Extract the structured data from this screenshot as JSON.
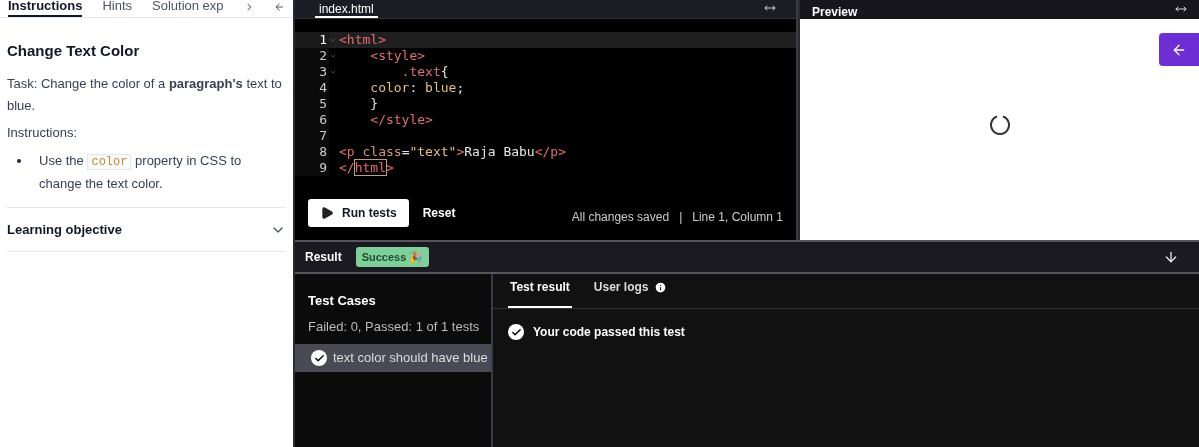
{
  "instructions_panel": {
    "tabs": [
      {
        "label": "Instructions",
        "selected": true
      },
      {
        "label": "Hints",
        "selected": false
      },
      {
        "label": "Solution exp",
        "selected": false
      }
    ],
    "title": "Change Text Color",
    "task": "Task: Change the color of a **paragraph's** text to blue.",
    "instructions_label": "Instructions:",
    "bullets": [
      {
        "before": "Use the",
        "code": "color",
        "after": "property in CSS to change the text color."
      }
    ],
    "accordion": {
      "label": "Learning objective",
      "expanded": false
    }
  },
  "editor": {
    "tab": {
      "label": "index.html",
      "selected": true
    },
    "lines": [
      {
        "number": "1",
        "fold": true,
        "current": true,
        "tokens": [
          {
            "kind": "tag",
            "text": "<html>"
          }
        ]
      },
      {
        "number": "2",
        "fold": true,
        "current": false,
        "tokens": [
          {
            "kind": "tag",
            "text": "    <style>"
          }
        ]
      },
      {
        "number": "3",
        "fold": true,
        "current": false,
        "tokens": [
          {
            "kind": "tag",
            "text": "        .text"
          },
          {
            "kind": "plain",
            "text": "{"
          }
        ]
      },
      {
        "number": "4",
        "fold": false,
        "current": false,
        "tokens": [
          {
            "kind": "prop",
            "text": "    color"
          },
          {
            "kind": "plain",
            "text": ": "
          },
          {
            "kind": "value",
            "text": "blue"
          },
          {
            "kind": "plain",
            "text": ";"
          }
        ]
      },
      {
        "number": "5",
        "fold": false,
        "current": false,
        "tokens": [
          {
            "kind": "plain",
            "text": "    }"
          }
        ]
      },
      {
        "number": "6",
        "fold": false,
        "current": false,
        "tokens": [
          {
            "kind": "tag",
            "text": "    </style>"
          }
        ]
      },
      {
        "number": "7",
        "fold": false,
        "current": false
      },
      {
        "number": "8",
        "fold": false,
        "current": false,
        "tokens": [
          {
            "kind": "tag",
            "text": "<p "
          },
          {
            "kind": "attr",
            "text": "class"
          },
          {
            "kind": "plain",
            "text": "="
          },
          {
            "kind": "string",
            "text": "\"text\""
          },
          {
            "kind": "tag",
            "text": ">"
          },
          {
            "kind": "plain",
            "text": "Raja Babu"
          },
          {
            "kind": "tag",
            "text": "</p>"
          }
        ]
      },
      {
        "number": "9",
        "fold": false,
        "current": false,
        "tokens": [
          {
            "kind": "tag",
            "text": "</"
          },
          {
            "kind": "match",
            "text": "html"
          },
          {
            "kind": "tag",
            "text": ">"
          }
        ]
      }
    ],
    "run_button": "Run tests",
    "reset_button": "Reset",
    "save_status": "All changes saved",
    "separator": "|",
    "cursor_position": "Line 1, Column 1"
  },
  "preview": {
    "title": "Preview",
    "loading": true
  },
  "result": {
    "title": "Result",
    "badge": "Success 🎉",
    "test_cases": {
      "title": "Test Cases",
      "summary": "Failed: 0, Passed: 1 of 1 tests",
      "items": [
        {
          "label": "text color should have blue",
          "passed": true,
          "selected": true
        }
      ]
    },
    "tabs": [
      {
        "label": "Test result",
        "selected": true,
        "info": false
      },
      {
        "label": "User logs",
        "selected": false,
        "info": true
      }
    ],
    "message": "Your code passed this test"
  }
}
